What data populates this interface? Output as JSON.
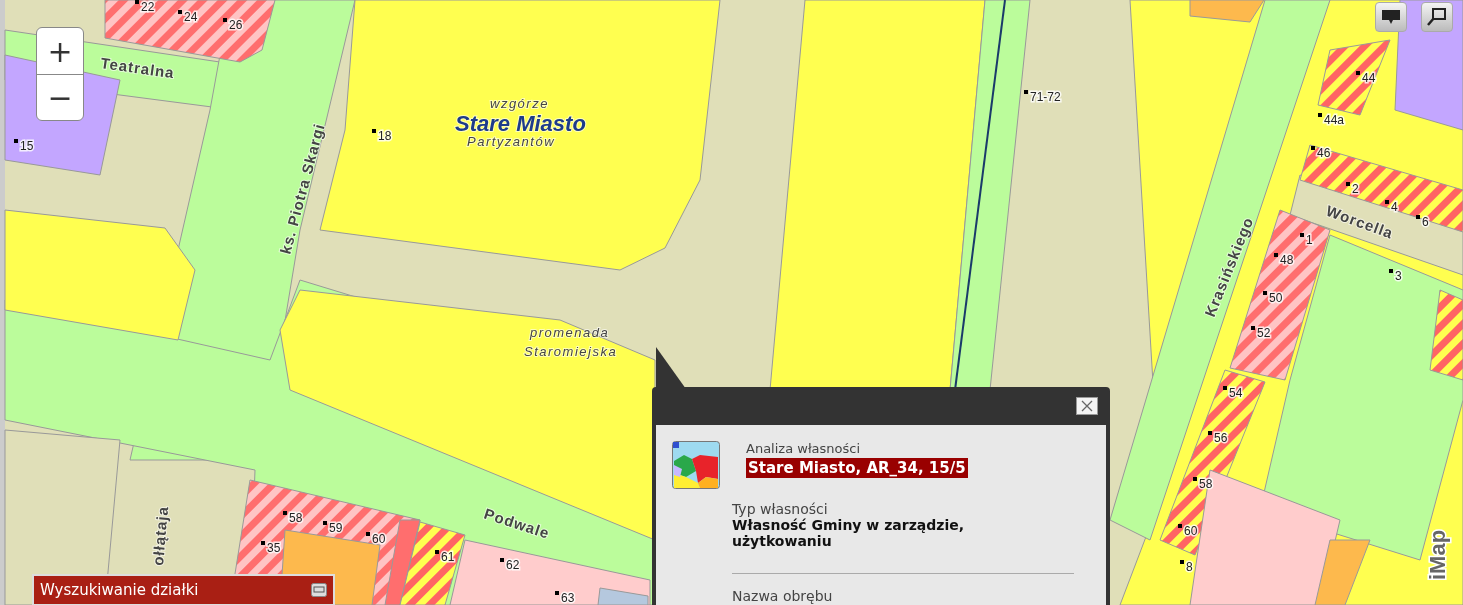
{
  "map": {
    "labels": [
      {
        "text": "Teatralna",
        "kind": "street"
      },
      {
        "text": "ks. Piotra Skargi",
        "kind": "street"
      },
      {
        "text": "Krasińskiego",
        "kind": "street"
      },
      {
        "text": "Worcella",
        "kind": "street"
      },
      {
        "text": "Podwale",
        "kind": "street"
      },
      {
        "text": "ołłątaja",
        "kind": "street"
      },
      {
        "text": "wzgórze",
        "kind": "area"
      },
      {
        "text": "Stare Miasto",
        "kind": "district"
      },
      {
        "text": "Partyzantów",
        "kind": "area"
      },
      {
        "text": "promenada",
        "kind": "area"
      },
      {
        "text": "Staromiejska",
        "kind": "area"
      },
      {
        "text": "22",
        "kind": "number"
      },
      {
        "text": "24",
        "kind": "number"
      },
      {
        "text": "26",
        "kind": "number"
      },
      {
        "text": "15",
        "kind": "number"
      },
      {
        "text": "18",
        "kind": "number"
      },
      {
        "text": "71-72",
        "kind": "number"
      },
      {
        "text": "44",
        "kind": "number"
      },
      {
        "text": "44a",
        "kind": "number"
      },
      {
        "text": "46",
        "kind": "number"
      },
      {
        "text": "2",
        "kind": "number"
      },
      {
        "text": "4",
        "kind": "number"
      },
      {
        "text": "6",
        "kind": "number"
      },
      {
        "text": "1",
        "kind": "number"
      },
      {
        "text": "48",
        "kind": "number"
      },
      {
        "text": "50",
        "kind": "number"
      },
      {
        "text": "52",
        "kind": "number"
      },
      {
        "text": "3",
        "kind": "number"
      },
      {
        "text": "54",
        "kind": "number"
      },
      {
        "text": "56",
        "kind": "number"
      },
      {
        "text": "58",
        "kind": "number"
      },
      {
        "text": "60",
        "kind": "number"
      },
      {
        "text": "8",
        "kind": "number"
      },
      {
        "text": "58",
        "kind": "number"
      },
      {
        "text": "59",
        "kind": "number"
      },
      {
        "text": "60",
        "kind": "number"
      },
      {
        "text": "35",
        "kind": "number"
      },
      {
        "text": "61",
        "kind": "number"
      },
      {
        "text": "62",
        "kind": "number"
      },
      {
        "text": "63",
        "kind": "number"
      }
    ],
    "logo": "iMap"
  },
  "zoom": {
    "in": "+",
    "out": "−"
  },
  "popup": {
    "title": "Analiza własności",
    "parcel": "Stare Miasto, AR_34, 15/5",
    "fields": [
      {
        "label": "Typ własności",
        "value": "Własność Gminy w zarządzie, użytkowaniu"
      },
      {
        "label": "Nazwa obrębu"
      }
    ]
  },
  "search_panel": {
    "title": "Wyszukiwanie działki"
  }
}
